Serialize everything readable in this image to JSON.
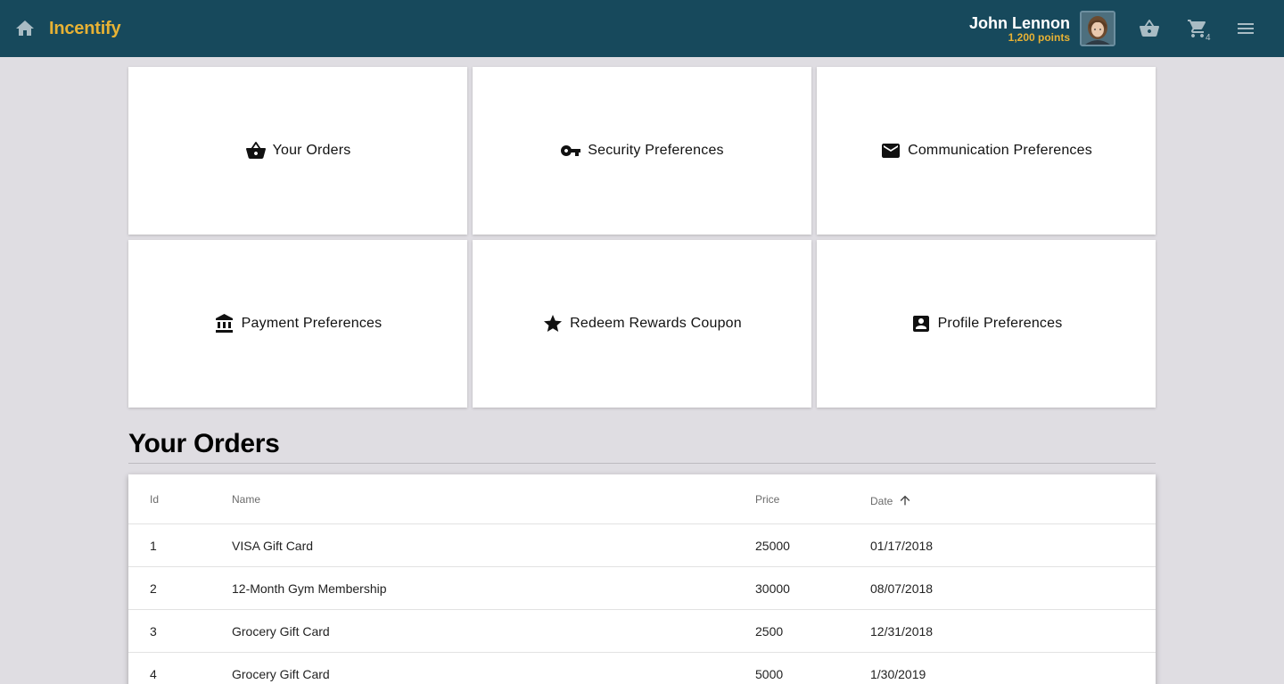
{
  "header": {
    "brand": "Incentify",
    "user_name": "John Lennon",
    "user_points": "1,200 points",
    "cart_count": "4",
    "colors": {
      "bar": "#17495c",
      "accent": "#e8b234"
    },
    "icons": [
      "home-icon",
      "basket-icon",
      "cart-icon",
      "menu-icon"
    ]
  },
  "tiles": [
    {
      "label": "Your Orders",
      "icon": "basket-icon"
    },
    {
      "label": "Security Preferences",
      "icon": "key-icon"
    },
    {
      "label": "Communication Preferences",
      "icon": "mail-icon"
    },
    {
      "label": "Payment Preferences",
      "icon": "bank-icon"
    },
    {
      "label": "Redeem Rewards Coupon",
      "icon": "star-icon"
    },
    {
      "label": "Profile Preferences",
      "icon": "contact-card-icon"
    }
  ],
  "orders": {
    "title": "Your Orders",
    "columns": {
      "id": "Id",
      "name": "Name",
      "price": "Price",
      "date": "Date"
    },
    "sort": {
      "column": "Date",
      "direction": "ascending"
    },
    "rows": [
      {
        "id": "1",
        "name": "VISA Gift Card",
        "price": "25000",
        "date": "01/17/2018"
      },
      {
        "id": "2",
        "name": "12-Month Gym Membership",
        "price": "30000",
        "date": "08/07/2018"
      },
      {
        "id": "3",
        "name": "Grocery Gift Card",
        "price": "2500",
        "date": "12/31/2018"
      },
      {
        "id": "4",
        "name": "Grocery Gift Card",
        "price": "5000",
        "date": "1/30/2019"
      }
    ]
  }
}
